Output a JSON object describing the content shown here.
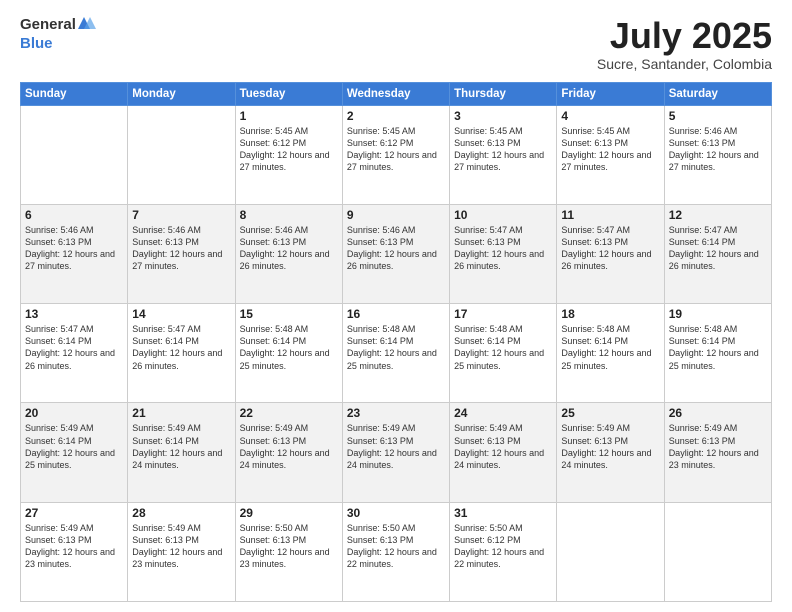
{
  "logo": {
    "general": "General",
    "blue": "Blue"
  },
  "header": {
    "month": "July 2025",
    "location": "Sucre, Santander, Colombia"
  },
  "weekdays": [
    "Sunday",
    "Monday",
    "Tuesday",
    "Wednesday",
    "Thursday",
    "Friday",
    "Saturday"
  ],
  "weeks": [
    [
      {
        "day": "",
        "info": ""
      },
      {
        "day": "",
        "info": ""
      },
      {
        "day": "1",
        "info": "Sunrise: 5:45 AM\nSunset: 6:12 PM\nDaylight: 12 hours and 27 minutes."
      },
      {
        "day": "2",
        "info": "Sunrise: 5:45 AM\nSunset: 6:12 PM\nDaylight: 12 hours and 27 minutes."
      },
      {
        "day": "3",
        "info": "Sunrise: 5:45 AM\nSunset: 6:13 PM\nDaylight: 12 hours and 27 minutes."
      },
      {
        "day": "4",
        "info": "Sunrise: 5:45 AM\nSunset: 6:13 PM\nDaylight: 12 hours and 27 minutes."
      },
      {
        "day": "5",
        "info": "Sunrise: 5:46 AM\nSunset: 6:13 PM\nDaylight: 12 hours and 27 minutes."
      }
    ],
    [
      {
        "day": "6",
        "info": "Sunrise: 5:46 AM\nSunset: 6:13 PM\nDaylight: 12 hours and 27 minutes."
      },
      {
        "day": "7",
        "info": "Sunrise: 5:46 AM\nSunset: 6:13 PM\nDaylight: 12 hours and 27 minutes."
      },
      {
        "day": "8",
        "info": "Sunrise: 5:46 AM\nSunset: 6:13 PM\nDaylight: 12 hours and 26 minutes."
      },
      {
        "day": "9",
        "info": "Sunrise: 5:46 AM\nSunset: 6:13 PM\nDaylight: 12 hours and 26 minutes."
      },
      {
        "day": "10",
        "info": "Sunrise: 5:47 AM\nSunset: 6:13 PM\nDaylight: 12 hours and 26 minutes."
      },
      {
        "day": "11",
        "info": "Sunrise: 5:47 AM\nSunset: 6:13 PM\nDaylight: 12 hours and 26 minutes."
      },
      {
        "day": "12",
        "info": "Sunrise: 5:47 AM\nSunset: 6:14 PM\nDaylight: 12 hours and 26 minutes."
      }
    ],
    [
      {
        "day": "13",
        "info": "Sunrise: 5:47 AM\nSunset: 6:14 PM\nDaylight: 12 hours and 26 minutes."
      },
      {
        "day": "14",
        "info": "Sunrise: 5:47 AM\nSunset: 6:14 PM\nDaylight: 12 hours and 26 minutes."
      },
      {
        "day": "15",
        "info": "Sunrise: 5:48 AM\nSunset: 6:14 PM\nDaylight: 12 hours and 25 minutes."
      },
      {
        "day": "16",
        "info": "Sunrise: 5:48 AM\nSunset: 6:14 PM\nDaylight: 12 hours and 25 minutes."
      },
      {
        "day": "17",
        "info": "Sunrise: 5:48 AM\nSunset: 6:14 PM\nDaylight: 12 hours and 25 minutes."
      },
      {
        "day": "18",
        "info": "Sunrise: 5:48 AM\nSunset: 6:14 PM\nDaylight: 12 hours and 25 minutes."
      },
      {
        "day": "19",
        "info": "Sunrise: 5:48 AM\nSunset: 6:14 PM\nDaylight: 12 hours and 25 minutes."
      }
    ],
    [
      {
        "day": "20",
        "info": "Sunrise: 5:49 AM\nSunset: 6:14 PM\nDaylight: 12 hours and 25 minutes."
      },
      {
        "day": "21",
        "info": "Sunrise: 5:49 AM\nSunset: 6:14 PM\nDaylight: 12 hours and 24 minutes."
      },
      {
        "day": "22",
        "info": "Sunrise: 5:49 AM\nSunset: 6:13 PM\nDaylight: 12 hours and 24 minutes."
      },
      {
        "day": "23",
        "info": "Sunrise: 5:49 AM\nSunset: 6:13 PM\nDaylight: 12 hours and 24 minutes."
      },
      {
        "day": "24",
        "info": "Sunrise: 5:49 AM\nSunset: 6:13 PM\nDaylight: 12 hours and 24 minutes."
      },
      {
        "day": "25",
        "info": "Sunrise: 5:49 AM\nSunset: 6:13 PM\nDaylight: 12 hours and 24 minutes."
      },
      {
        "day": "26",
        "info": "Sunrise: 5:49 AM\nSunset: 6:13 PM\nDaylight: 12 hours and 23 minutes."
      }
    ],
    [
      {
        "day": "27",
        "info": "Sunrise: 5:49 AM\nSunset: 6:13 PM\nDaylight: 12 hours and 23 minutes."
      },
      {
        "day": "28",
        "info": "Sunrise: 5:49 AM\nSunset: 6:13 PM\nDaylight: 12 hours and 23 minutes."
      },
      {
        "day": "29",
        "info": "Sunrise: 5:50 AM\nSunset: 6:13 PM\nDaylight: 12 hours and 23 minutes."
      },
      {
        "day": "30",
        "info": "Sunrise: 5:50 AM\nSunset: 6:13 PM\nDaylight: 12 hours and 22 minutes."
      },
      {
        "day": "31",
        "info": "Sunrise: 5:50 AM\nSunset: 6:12 PM\nDaylight: 12 hours and 22 minutes."
      },
      {
        "day": "",
        "info": ""
      },
      {
        "day": "",
        "info": ""
      }
    ]
  ]
}
